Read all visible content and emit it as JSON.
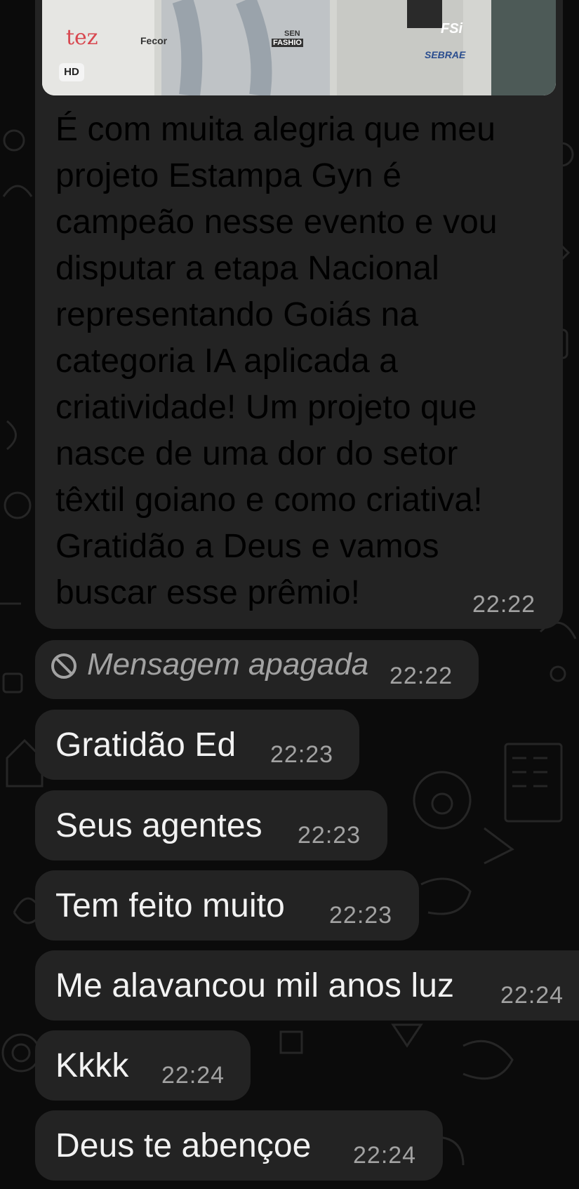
{
  "chat": {
    "image_message": {
      "hd_badge": "HD",
      "sponsor_texts": [
        "tez",
        "Fecor",
        "SEN",
        "FASHIO",
        "FSi",
        "SEBRAE"
      ],
      "caption_lines": [
        "É com muita alegria que meu",
        "projeto Estampa Gyn é",
        "campeão nesse evento e vou",
        "disputar a etapa Nacional",
        "representando Goiás na",
        "categoria IA aplicada a",
        "criatividade! Um projeto que",
        "nasce de uma dor do setor",
        "têxtil goiano e como criativa!",
        "Gratidão a Deus e vamos",
        "buscar esse prêmio!"
      ],
      "time": "22:22"
    },
    "deleted_message": {
      "text": "Mensagem apagada",
      "time": "22:22",
      "icon": "prohibited-icon"
    },
    "messages": [
      {
        "text": "Gratidão Ed",
        "time": "22:23"
      },
      {
        "text": "Seus agentes",
        "time": "22:23"
      },
      {
        "text": "Tem feito muito",
        "time": "22:23"
      },
      {
        "text": "Me alavancou mil anos luz",
        "time": "22:24"
      },
      {
        "text": "Kkkk",
        "time": "22:24"
      },
      {
        "text": "Deus te abençoe",
        "time": "22:24"
      }
    ]
  },
  "colors": {
    "background": "#0b0b0b",
    "bubble": "#232323",
    "text": "#f2f2f2",
    "timestamp": "#a2a2a2",
    "doodle": "#2a2a2a"
  }
}
